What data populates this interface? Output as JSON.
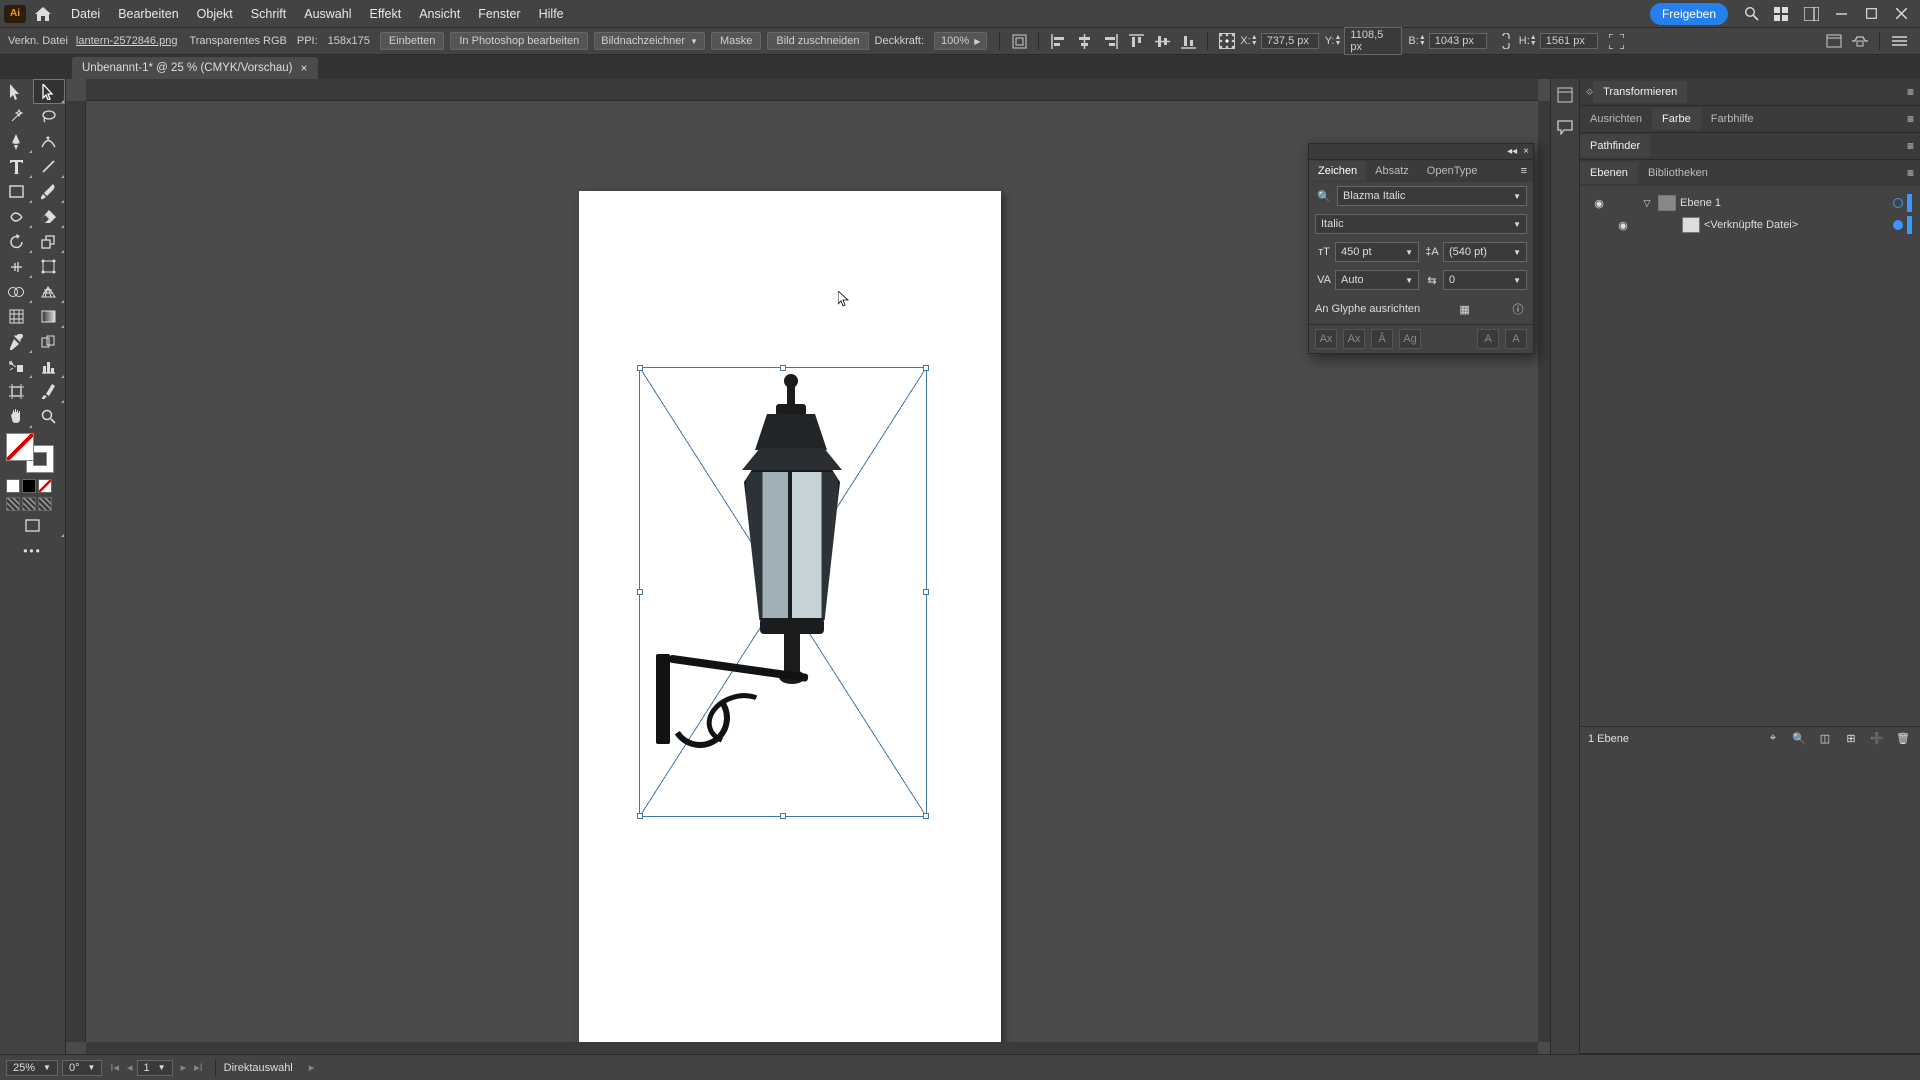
{
  "menu": {
    "items": [
      "Datei",
      "Bearbeiten",
      "Objekt",
      "Schrift",
      "Auswahl",
      "Effekt",
      "Ansicht",
      "Fenster",
      "Hilfe"
    ],
    "share": "Freigeben"
  },
  "ctrl": {
    "label": "Verkn. Datei",
    "filename": "lantern-2572846.png",
    "colormode": "Transparentes RGB",
    "ppi_label": "PPI:",
    "ppi": "158x175",
    "embed": "Einbetten",
    "editps": "In Photoshop bearbeiten",
    "tracer": "Bildnachzeichner",
    "mask": "Maske",
    "crop": "Bild zuschneiden",
    "opacity_label": "Deckkraft:",
    "opacity": "100%",
    "x_label": "X:",
    "x": "737,5 px",
    "y_label": "Y:",
    "y": "1108,5 px",
    "w_label": "B:",
    "w": "1043 px",
    "h_label": "H:",
    "h": "1561 px"
  },
  "tab": {
    "title": "Unbenannt-1* @ 25 % (CMYK/Vorschau)"
  },
  "charPanel": {
    "tabs": [
      "Zeichen",
      "Absatz",
      "OpenType"
    ],
    "font": "Blazma Italic",
    "style": "Italic",
    "size": "450 pt",
    "leading": "(540 pt)",
    "kerning": "Auto",
    "tracking": "0",
    "glyph": "An Glyphe ausrichten"
  },
  "right": {
    "transform": "Transformieren",
    "align": "Ausrichten",
    "color": "Farbe",
    "colorguide": "Farbhilfe",
    "pathfinder": "Pathfinder",
    "layers": "Ebenen",
    "libs": "Bibliotheken",
    "layer1": "Ebene 1",
    "linked": "<Verknüpfte Datei>",
    "footer": "1 Ebene"
  },
  "status": {
    "zoom": "25%",
    "rot": "0°",
    "artboard": "1",
    "tool": "Direktauswahl"
  }
}
